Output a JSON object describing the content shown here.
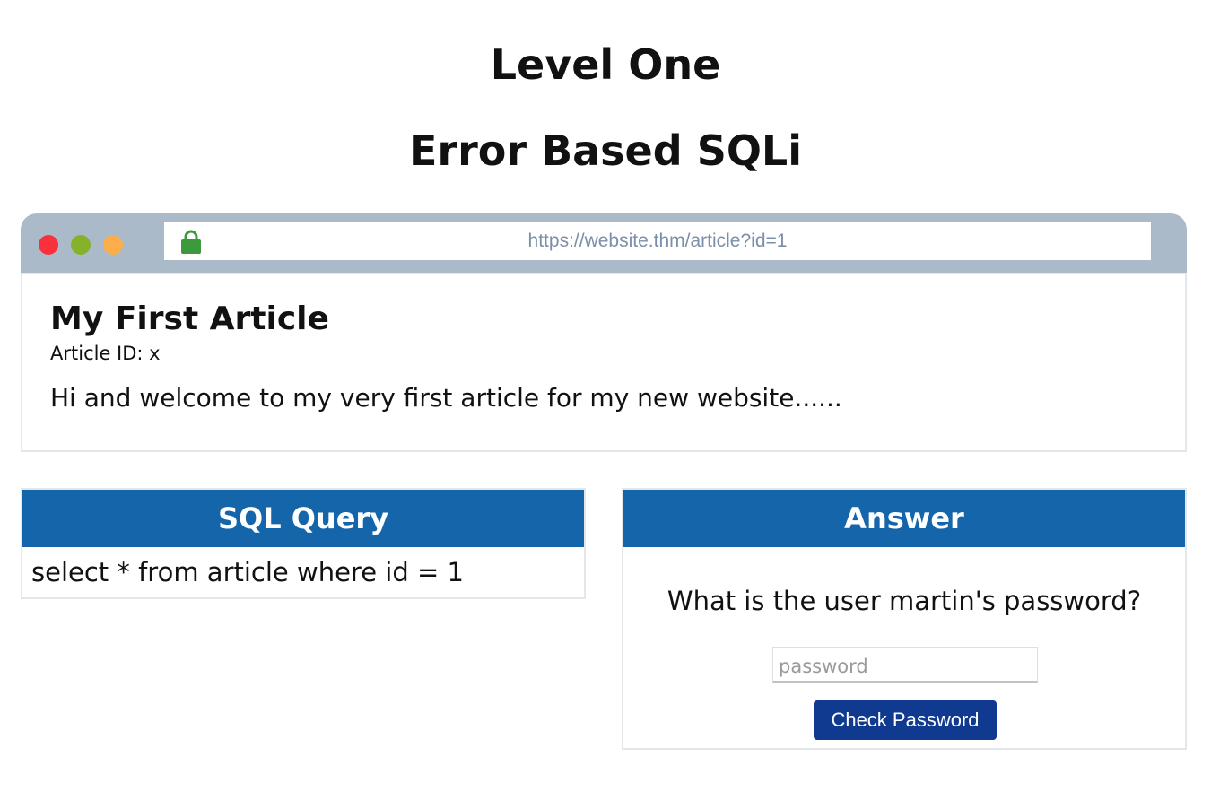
{
  "page": {
    "title": "Level One",
    "subtitle": "Error Based SQLi"
  },
  "browser": {
    "url": "https://website.thm/article?id=1",
    "article": {
      "title": "My First Article",
      "id_line": "Article ID: x",
      "body": "Hi and welcome to my very first article for my new website......"
    }
  },
  "sql_panel": {
    "header": "SQL Query",
    "query": "select * from article where id = 1"
  },
  "answer_panel": {
    "header": "Answer",
    "question": "What is the user martin's password?",
    "input_placeholder": "password",
    "input_value": "",
    "button_label": "Check Password"
  },
  "colors": {
    "header_blue": "#1565ab",
    "button_navy": "#0f3a8f",
    "browser_bar": "#abbac8",
    "dot_red": "#f8313d",
    "dot_green": "#85b22a",
    "dot_orange": "#fbae4b",
    "lock_green": "#3c9a3c"
  },
  "icons": {
    "lock": "lock-icon",
    "window_controls": [
      "close-dot",
      "minimize-dot",
      "maximize-dot"
    ]
  }
}
